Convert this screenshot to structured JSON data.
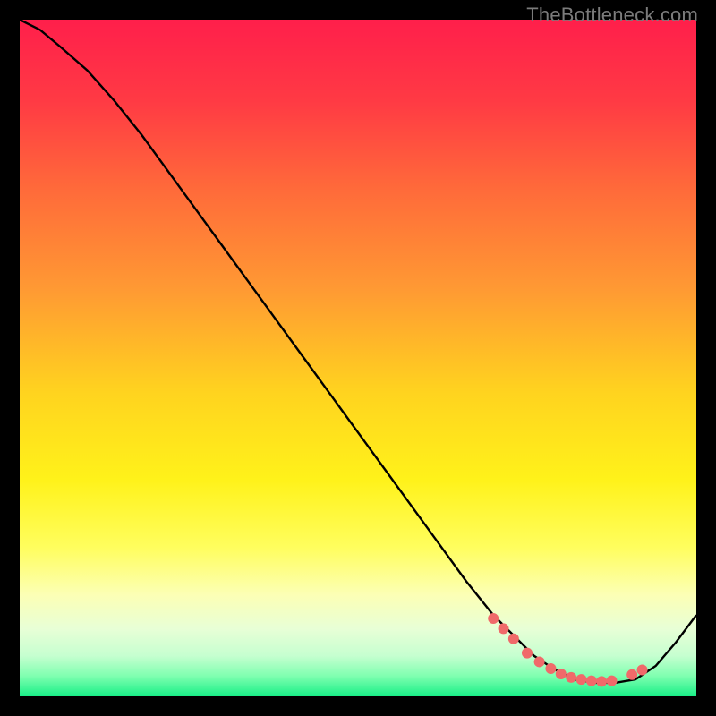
{
  "watermark": "TheBottleneck.com",
  "chart_data": {
    "type": "line",
    "title": "",
    "xlabel": "",
    "ylabel": "",
    "xlim": [
      0,
      100
    ],
    "ylim": [
      0,
      100
    ],
    "grid": false,
    "legend": false,
    "background_gradient": {
      "stops": [
        {
          "offset": 0.0,
          "color": "#ff1f4b"
        },
        {
          "offset": 0.12,
          "color": "#ff3a44"
        },
        {
          "offset": 0.25,
          "color": "#ff6a3a"
        },
        {
          "offset": 0.4,
          "color": "#ff9a33"
        },
        {
          "offset": 0.55,
          "color": "#ffd31f"
        },
        {
          "offset": 0.68,
          "color": "#fff21a"
        },
        {
          "offset": 0.78,
          "color": "#fffe5e"
        },
        {
          "offset": 0.85,
          "color": "#fcffb5"
        },
        {
          "offset": 0.9,
          "color": "#e8ffd6"
        },
        {
          "offset": 0.94,
          "color": "#c6ffd0"
        },
        {
          "offset": 0.97,
          "color": "#7fffb0"
        },
        {
          "offset": 1.0,
          "color": "#19ef87"
        }
      ]
    },
    "series": [
      {
        "name": "curve",
        "type": "line",
        "color": "#000000",
        "x": [
          0,
          3,
          6,
          10,
          14,
          18,
          22,
          26,
          30,
          34,
          38,
          42,
          46,
          50,
          54,
          58,
          62,
          66,
          70,
          73,
          76,
          79,
          82,
          85,
          88,
          91,
          94,
          97,
          100
        ],
        "y": [
          100,
          98.5,
          96,
          92.5,
          88,
          83,
          77.5,
          72,
          66.5,
          61,
          55.5,
          50,
          44.5,
          39,
          33.5,
          28,
          22.5,
          17,
          12,
          9,
          6,
          4,
          2.5,
          2,
          2,
          2.5,
          4.5,
          8,
          12
        ]
      },
      {
        "name": "trough-points",
        "type": "scatter",
        "color": "#f06a6a",
        "radius": 6,
        "x": [
          70,
          71.5,
          73,
          75,
          76.8,
          78.5,
          80,
          81.5,
          83,
          84.5,
          86,
          87.5,
          90.5,
          92
        ],
        "y": [
          11.5,
          10,
          8.5,
          6.4,
          5.1,
          4.1,
          3.3,
          2.8,
          2.5,
          2.3,
          2.2,
          2.3,
          3.2,
          3.9
        ]
      }
    ]
  }
}
